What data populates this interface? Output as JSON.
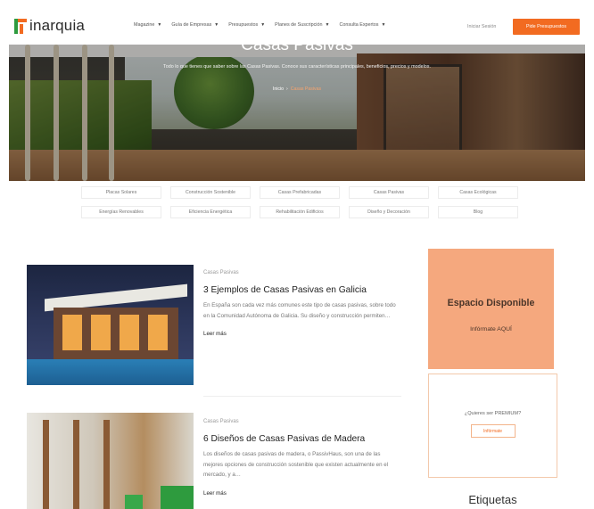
{
  "header": {
    "logo": "inarquia",
    "nav": [
      {
        "label": "Magazine"
      },
      {
        "label": "Guía de Empresas"
      },
      {
        "label": "Presupuestos"
      },
      {
        "label": "Planes de Suscripción"
      },
      {
        "label": "Consulta Expertos"
      }
    ],
    "login": "Iniciar Sesión",
    "cta": "Pide Presupuestos"
  },
  "hero": {
    "title": "Casas Pasivas",
    "subtitle": "Todo lo que tienes que saber sobre las Casas Pasivas. Conoce sus características principales, beneficios, precios y modelos.",
    "breadcrumb": {
      "home": "Inicio",
      "current": "Casas Pasivas"
    }
  },
  "categories": [
    "Placas Solares",
    "Construcción Sostenible",
    "Casas Prefabricadas",
    "Casas Pasivas",
    "Casas Ecológicas",
    "Energías Renovables",
    "Eficiencia Energética",
    "Rehabilitación Edificios",
    "Diseño y Decoración",
    "Blog"
  ],
  "articles": [
    {
      "category": "Casas Pasivas",
      "title": "3 Ejemplos de Casas Pasivas en Galicia",
      "excerpt": "En España son cada vez más comunes este tipo de casas pasivas, sobre todo en la Comunidad Autónoma de Galicia. Su diseño y construcción permiten…",
      "more": "Leer más"
    },
    {
      "category": "Casas Pasivas",
      "title": "6 Diseños de Casas Pasivas de Madera",
      "excerpt": "Los diseños de casas pasivas de madera, o PassivHaus, son una de las mejores opciones de construcción sostenible que existen actualmente en el mercado, y a…",
      "more": "Leer más"
    }
  ],
  "sidebar": {
    "ad_title": "Espacio Disponible",
    "ad_subtitle": "Infórmate AQUÍ",
    "premium_question": "¿Quieres ser PREMIUM?",
    "premium_button": "Infórmate",
    "tags_heading": "Etiquetas"
  },
  "colors": {
    "accent": "#f26b21",
    "ad_background": "#f5a87e",
    "logo_green": "#2e9b3e"
  }
}
